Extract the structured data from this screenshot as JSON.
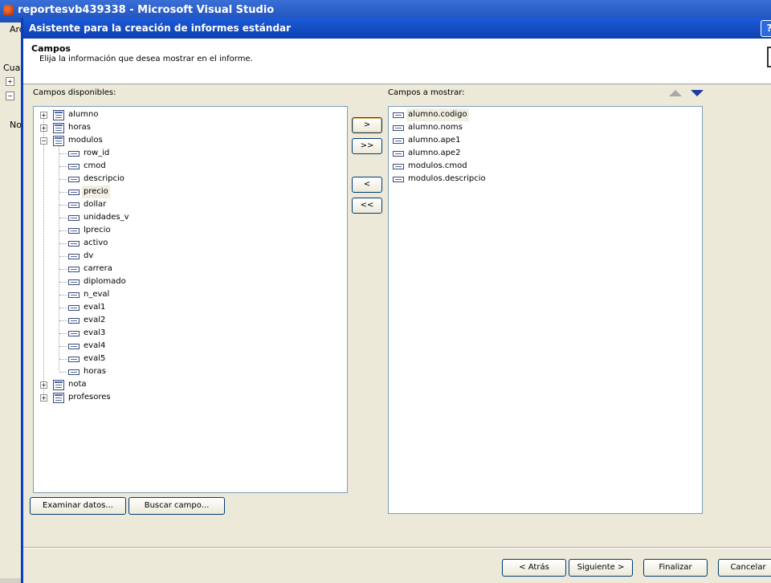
{
  "app": {
    "window_title": "reportesvb439338 - Microsoft Visual Studio",
    "menu_fragment": "Arc",
    "side_labels": [
      "Cuad",
      "No"
    ]
  },
  "dialog": {
    "title": "Asistente para la creación de informes estándar",
    "help": "?",
    "header_title": "Campos",
    "header_subtitle": "Elija la información que desea mostrar en el informe."
  },
  "available": {
    "label": "Campos disponibles:",
    "tables": [
      {
        "name": "alumno",
        "expanded": false
      },
      {
        "name": "horas",
        "expanded": false
      },
      {
        "name": "modulos",
        "expanded": true,
        "fields": [
          "row_id",
          "cmod",
          "descripcio",
          "precio",
          "dollar",
          "unidades_v",
          "lprecio",
          "activo",
          "dv",
          "carrera",
          "diplomado",
          "n_eval",
          "eval1",
          "eval2",
          "eval3",
          "eval4",
          "eval5",
          "horas"
        ],
        "selected_field": "precio"
      },
      {
        "name": "nota",
        "expanded": false
      },
      {
        "name": "profesores",
        "expanded": false
      }
    ]
  },
  "display": {
    "label": "Campos a mostrar:",
    "fields": [
      "alumno.codigo",
      "alumno.noms",
      "alumno.ape1",
      "alumno.ape2",
      "modulos.cmod",
      "modulos.descripcio"
    ],
    "selected": "alumno.codigo"
  },
  "move_buttons": {
    "add": ">",
    "add_all": ">>",
    "remove": "<",
    "remove_all": "<<"
  },
  "actions": {
    "browse": "Examinar datos...",
    "find": "Buscar campo..."
  },
  "nav": {
    "back": "< Atrás",
    "next": "Siguiente >",
    "finish": "Finalizar",
    "cancel": "Cancelar"
  }
}
